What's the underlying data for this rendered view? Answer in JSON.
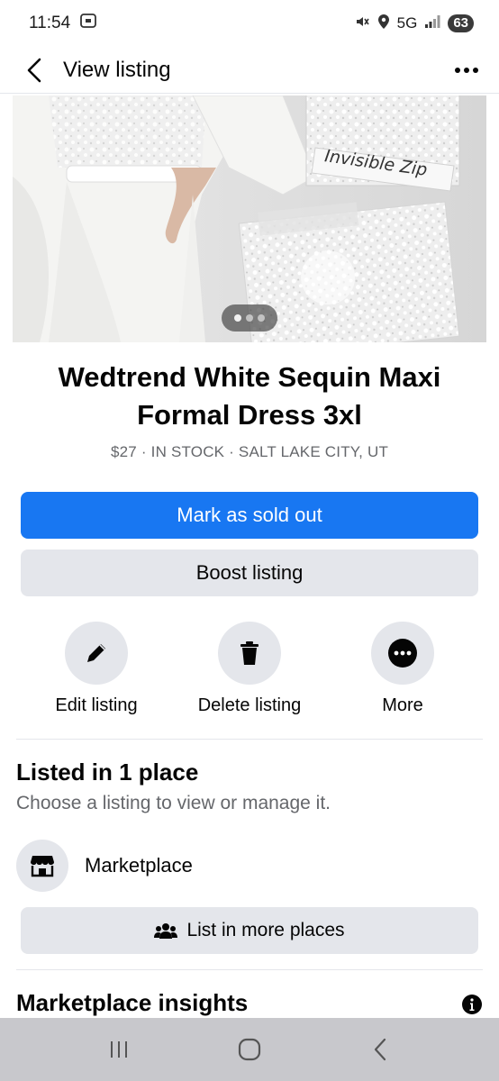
{
  "status_bar": {
    "time": "11:54",
    "network": "5G",
    "battery": "63"
  },
  "app_bar": {
    "title": "View listing"
  },
  "hero_image": {
    "overlay_text": "Invisible Zip",
    "current_page": 1,
    "page_count": 3
  },
  "listing": {
    "title": "Wedtrend White Sequin Maxi Formal Dress 3xl",
    "meta": "$27 · IN STOCK · SALT LAKE CITY, UT"
  },
  "buttons": {
    "mark_sold": "Mark as sold out",
    "boost": "Boost listing",
    "list_more": "List in more places"
  },
  "actions": [
    {
      "label": "Edit listing",
      "icon": "pencil-icon"
    },
    {
      "label": "Delete listing",
      "icon": "trash-icon"
    },
    {
      "label": "More",
      "icon": "more-icon"
    }
  ],
  "listed_section": {
    "title": "Listed in 1 place",
    "subtitle": "Choose a listing to view or manage it.",
    "places": [
      {
        "label": "Marketplace",
        "icon": "storefront-icon"
      }
    ]
  },
  "insights_section": {
    "title": "Marketplace insights"
  },
  "colors": {
    "primary": "#1877f2",
    "secondary_bg": "#e4e6eb",
    "muted_text": "#65676b",
    "nav_bar": "#c8c8cc"
  }
}
